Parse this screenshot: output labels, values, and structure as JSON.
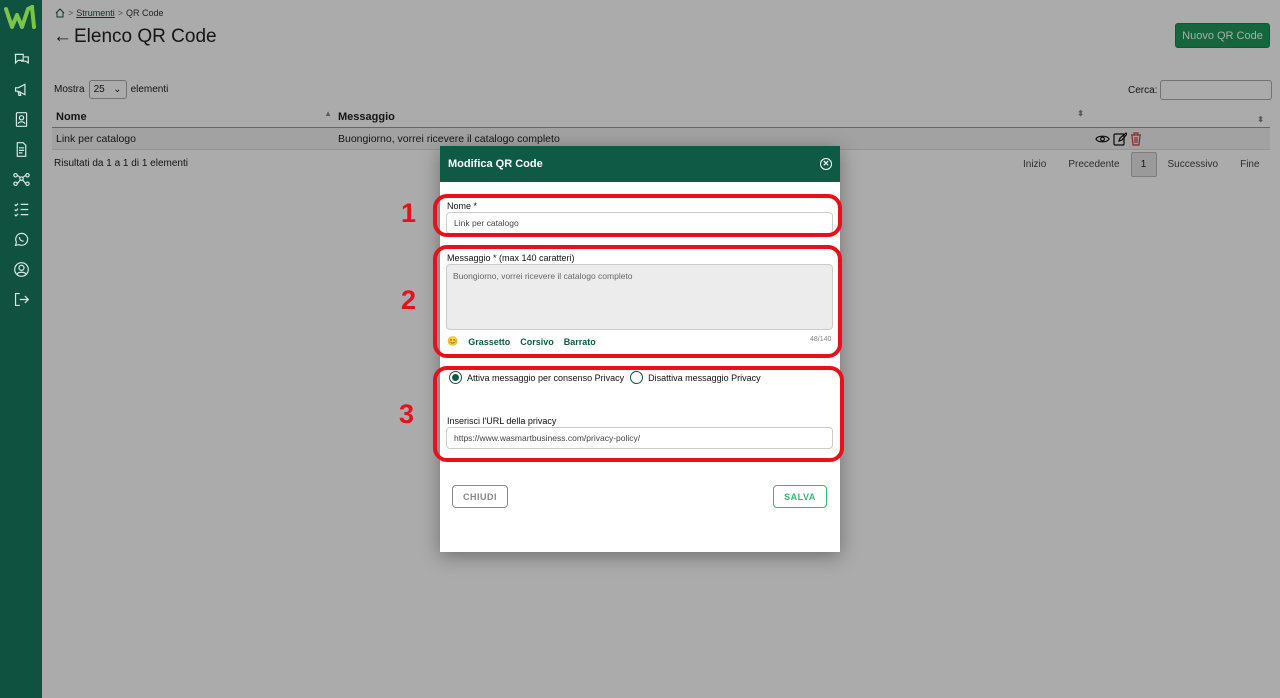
{
  "breadcrumb": {
    "link": "Strumenti",
    "separator": ">",
    "current": "QR Code"
  },
  "page": {
    "back_arrow": "←",
    "title": "Elenco QR Code",
    "new_button": "Nuovo QR Code"
  },
  "table_controls": {
    "show_label": "Mostra",
    "show_value": "25",
    "elements_label": "elementi",
    "search_label": "Cerca:"
  },
  "table": {
    "columns": [
      "Nome",
      "Messaggio"
    ],
    "rows": [
      {
        "nome": "Link per catalogo",
        "messaggio": "Buongiorno, vorrei ricevere il catalogo completo"
      }
    ]
  },
  "footer": {
    "results": "Risultati da 1 a 1 di 1 elementi",
    "pager": {
      "first": "Inizio",
      "prev": "Precedente",
      "page": "1",
      "next": "Successivo",
      "last": "Fine"
    }
  },
  "modal": {
    "title": "Modifica QR Code",
    "nome_label": "Nome *",
    "nome_value": "Link per catalogo",
    "messaggio_label": "Messaggio * (max 140 caratteri)",
    "messaggio_value": "Buongiorno, vorrei ricevere il catalogo completo",
    "emoji": "😊",
    "format_bold": "Grassetto",
    "format_italic": "Corsivo",
    "format_strike": "Barrato",
    "counter": "48/140",
    "radio_on": "Attiva messaggio per consenso Privacy",
    "radio_off": "Disattiva messaggio Privacy",
    "privacy_label": "Inserisci l'URL della privacy",
    "privacy_value": "https://www.wasmartbusiness.com/privacy-policy/",
    "close_button": "CHIUDI",
    "save_button": "SALVA"
  },
  "callouts": [
    "1",
    "2",
    "3"
  ],
  "colors": {
    "sidebar": "#0f5240",
    "primary": "#1e9a5a",
    "modal_header": "#0f5a44",
    "callout": "#e8101b"
  }
}
